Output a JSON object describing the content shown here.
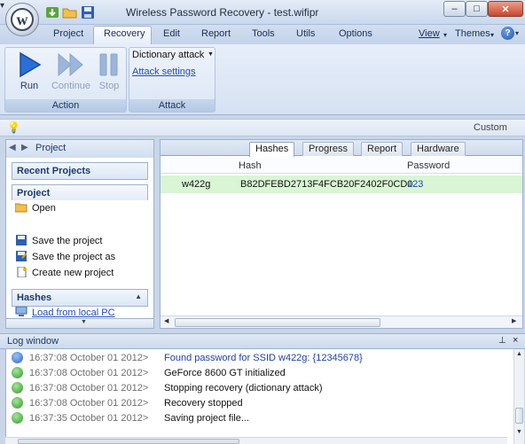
{
  "window": {
    "title": "Wireless Password Recovery - test.wifipr",
    "min_glyph": "–",
    "max_glyph": "□",
    "close_glyph": "✕"
  },
  "quick_access": {
    "more_glyph": "▾"
  },
  "ribbon": {
    "tabs": [
      {
        "label": "Project"
      },
      {
        "label": "Recovery",
        "active": true
      },
      {
        "label": "Edit"
      },
      {
        "label": "Report"
      },
      {
        "label": "Tools"
      },
      {
        "label": "Utils"
      },
      {
        "label": "Options"
      }
    ],
    "right_menus": {
      "view": "View",
      "themes": "Themes",
      "help": "?"
    },
    "groups": {
      "action": {
        "label": "Action",
        "run": "Run",
        "continue": "Continue",
        "stop": "Stop"
      },
      "attack": {
        "label": "Attack",
        "dictionary": "Dictionary attack",
        "settings": "Attack settings"
      }
    }
  },
  "infobar": {
    "custom": "Custom"
  },
  "left_panel": {
    "nav_label": "Project",
    "recent_header": "Recent Projects",
    "project_header": "Project",
    "open": "Open",
    "save": "Save the project",
    "save_as": "Save the project as",
    "create": "Create new project",
    "hashes_header": "Hashes",
    "load": "Load from local PC"
  },
  "right_panel": {
    "tabs": [
      "Hashes",
      "Progress",
      "Report",
      "Hardware"
    ],
    "active_tab": "Hashes",
    "columns": {
      "hash": "Hash",
      "password": "Password"
    },
    "rows": [
      {
        "name": "w422g",
        "hash": "B82DFEBD2713F4FCB20F2402F0CD0...",
        "password": "123"
      }
    ]
  },
  "log": {
    "title": "Log window",
    "pin": "⊥",
    "close": "×",
    "entries": [
      {
        "time": "16:37:08 October 01 2012>",
        "message": "Found password for SSID w422g: {12345678}",
        "type": "info",
        "color": "#1f3fb0"
      },
      {
        "time": "16:37:08 October 01 2012>",
        "message": "GeForce 8600 GT initialized",
        "type": "ok",
        "color": "#111111"
      },
      {
        "time": "16:37:08 October 01 2012>",
        "message": "Stopping recovery (dictionary attack)",
        "type": "ok",
        "color": "#111111"
      },
      {
        "time": "16:37:08 October 01 2012>",
        "message": "Recovery stopped",
        "type": "ok",
        "color": "#111111"
      },
      {
        "time": "16:37:35 October 01 2012>",
        "message": "Saving project file...",
        "type": "ok",
        "color": "#111111"
      }
    ]
  },
  "colors": {
    "accent": "#1f4fb5",
    "ribbon": "#d6e2f3",
    "found_row": "#d9f5d4",
    "ok_icon": "#2e9a2a",
    "info_icon": "#2d64c8"
  }
}
